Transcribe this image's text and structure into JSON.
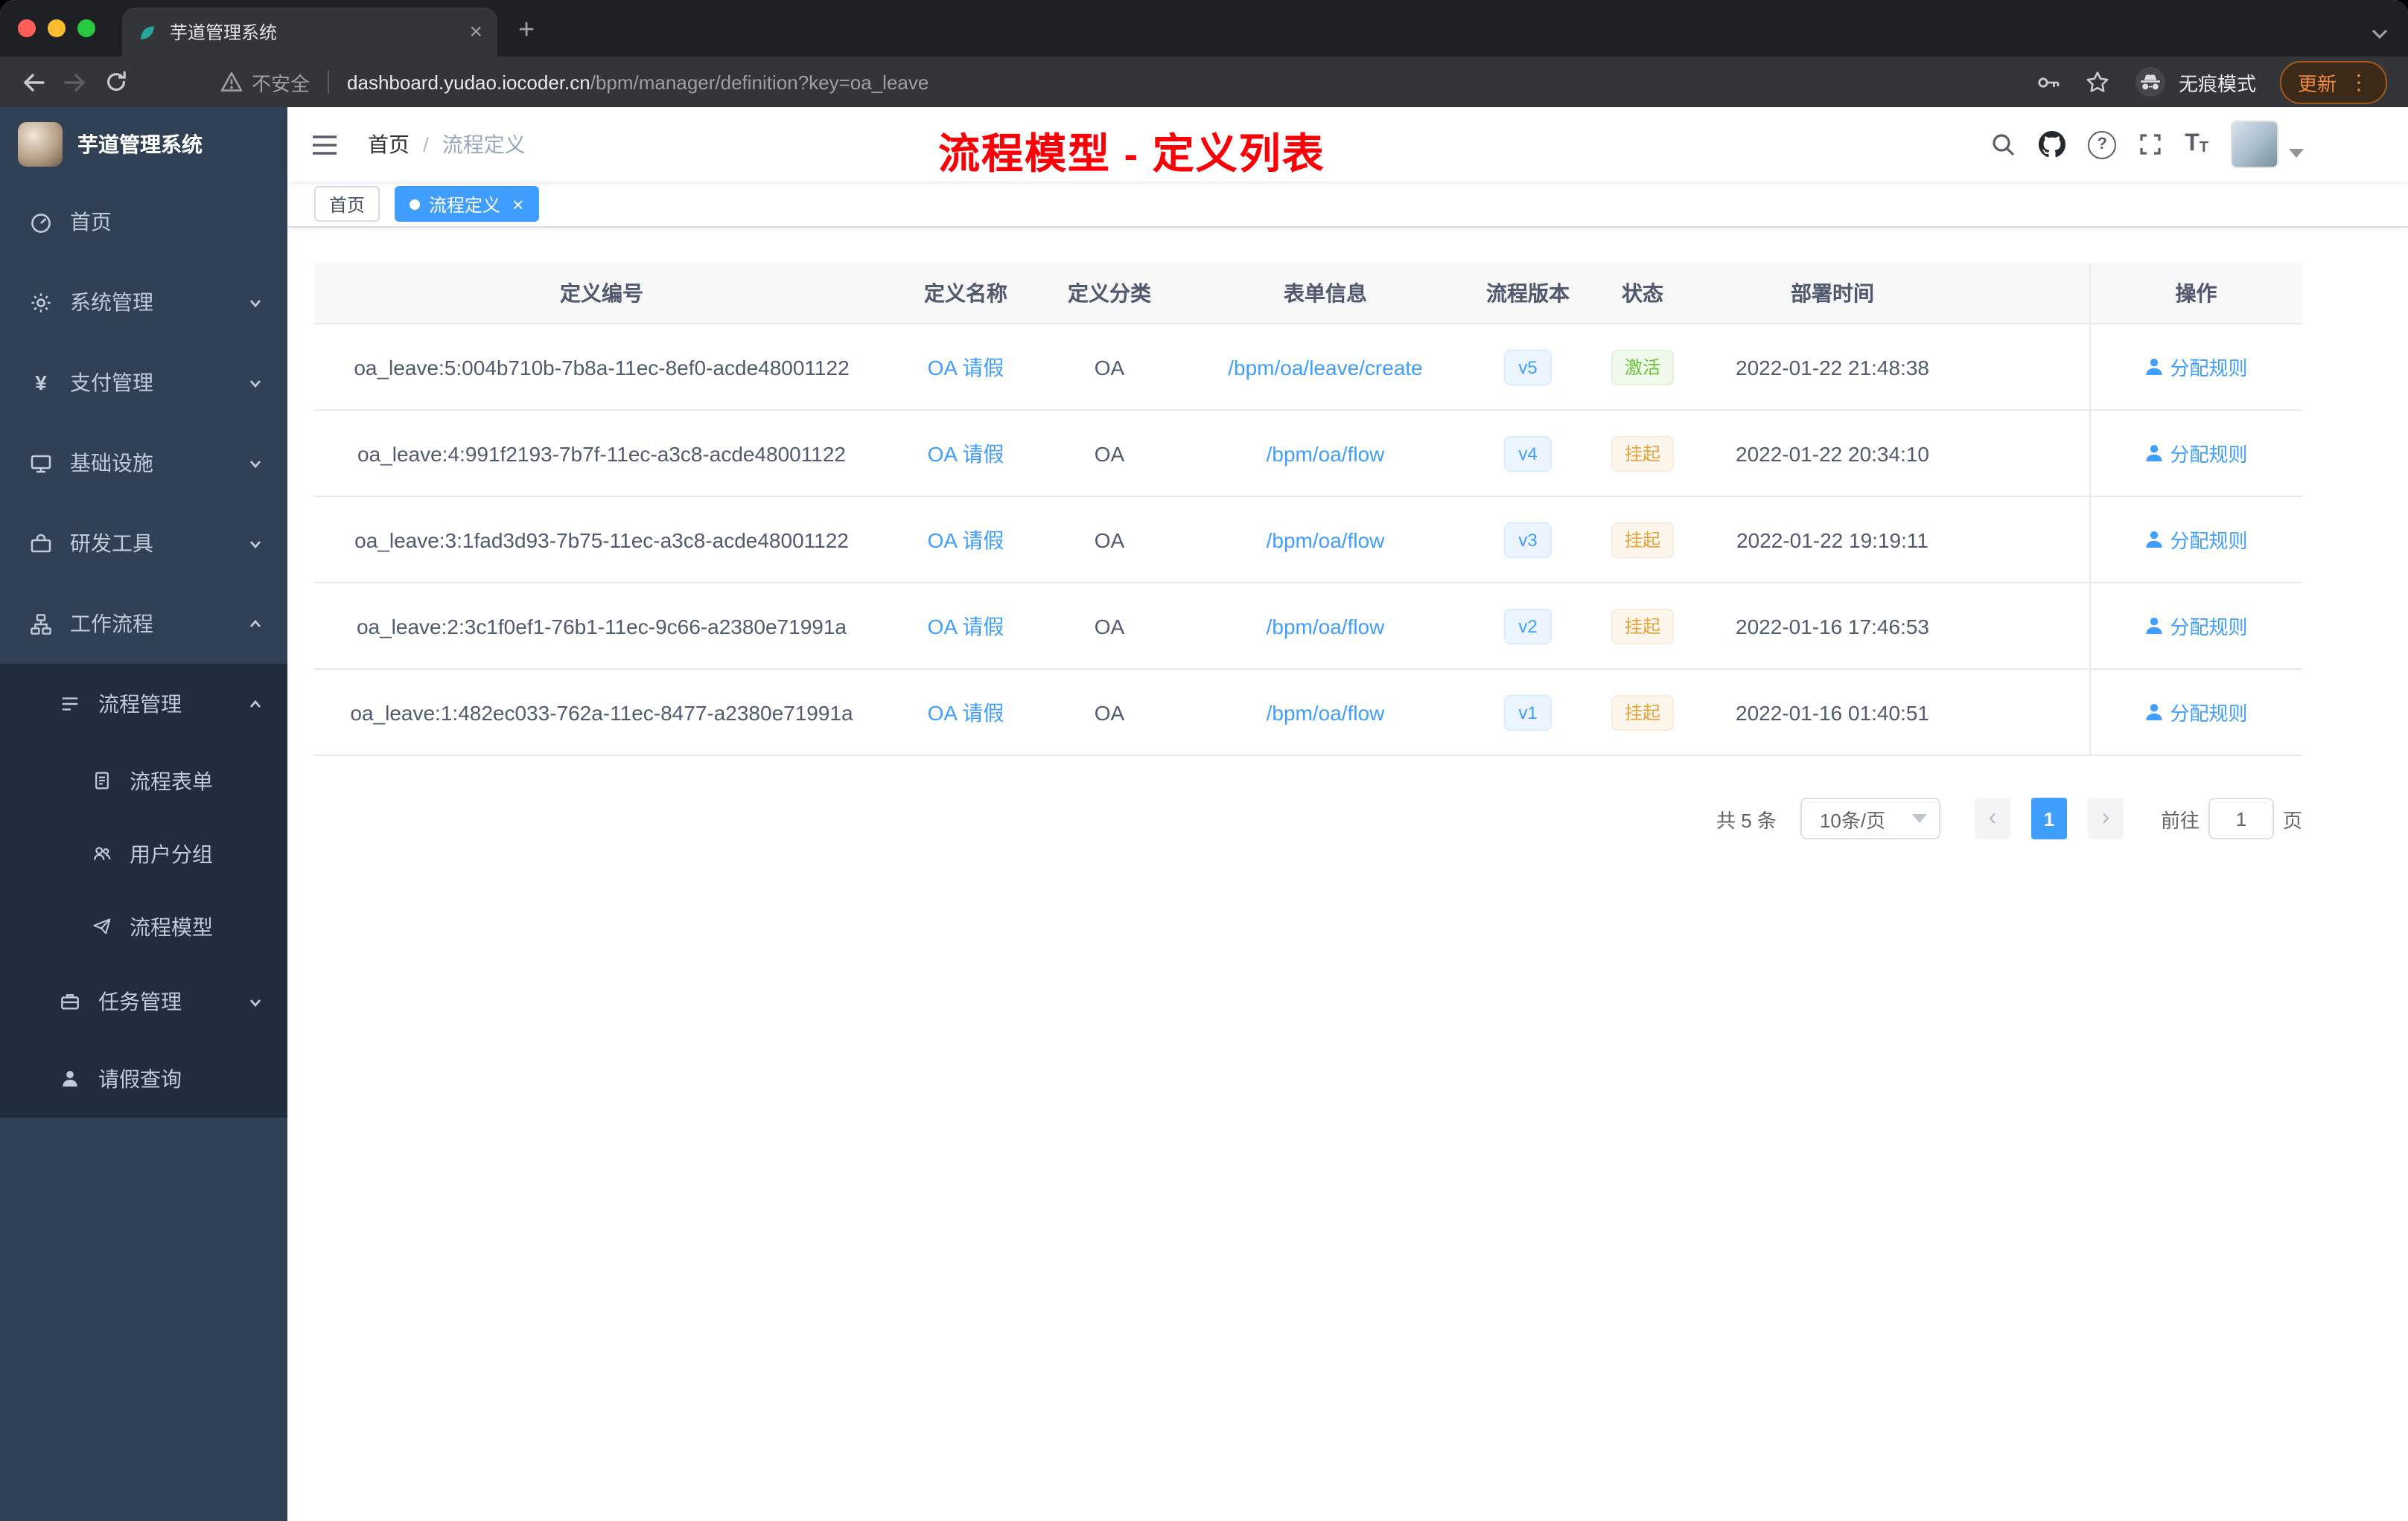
{
  "browser": {
    "tab_title": "芋道管理系统",
    "security_label": "不安全",
    "url_host": "dashboard.yudao.iocoder.cn",
    "url_path": "/bpm/manager/definition?key=oa_leave",
    "incognito_label": "无痕模式",
    "update_label": "更新"
  },
  "glyphs": {
    "close": "×",
    "plus": "+",
    "dots": "⋮",
    "prev": "‹",
    "next": "›",
    "question": "?",
    "t_large": "T",
    "t_small": "T"
  },
  "sidebar": {
    "brand": "芋道管理系统",
    "items": [
      {
        "label": "首页"
      },
      {
        "label": "系统管理"
      },
      {
        "label": "支付管理"
      },
      {
        "label": "基础设施"
      },
      {
        "label": "研发工具"
      },
      {
        "label": "工作流程"
      }
    ],
    "workflow": [
      {
        "label": "流程管理"
      },
      {
        "label": "流程表单"
      },
      {
        "label": "用户分组"
      },
      {
        "label": "流程模型"
      },
      {
        "label": "任务管理"
      },
      {
        "label": "请假查询"
      }
    ]
  },
  "header": {
    "breadcrumb_home": "首页",
    "breadcrumb_sep": "/",
    "breadcrumb_current": "流程定义",
    "annotation": "流程模型 - 定义列表"
  },
  "tags": [
    {
      "label": "首页"
    },
    {
      "label": "流程定义"
    }
  ],
  "table": {
    "columns": [
      "定义编号",
      "定义名称",
      "定义分类",
      "表单信息",
      "流程版本",
      "状态",
      "部署时间",
      "操作"
    ],
    "rows": [
      {
        "id": "oa_leave:5:004b710b-7b8a-11ec-8ef0-acde48001122",
        "name": "OA 请假",
        "category": "OA",
        "form": "/bpm/oa/leave/create",
        "version": "v5",
        "status": "激活",
        "deployed": "2022-01-22 21:48:38",
        "action": "分配规则"
      },
      {
        "id": "oa_leave:4:991f2193-7b7f-11ec-a3c8-acde48001122",
        "name": "OA 请假",
        "category": "OA",
        "form": "/bpm/oa/flow",
        "version": "v4",
        "status": "挂起",
        "deployed": "2022-01-22 20:34:10",
        "action": "分配规则"
      },
      {
        "id": "oa_leave:3:1fad3d93-7b75-11ec-a3c8-acde48001122",
        "name": "OA 请假",
        "category": "OA",
        "form": "/bpm/oa/flow",
        "version": "v3",
        "status": "挂起",
        "deployed": "2022-01-22 19:19:11",
        "action": "分配规则"
      },
      {
        "id": "oa_leave:2:3c1f0ef1-76b1-11ec-9c66-a2380e71991a",
        "name": "OA 请假",
        "category": "OA",
        "form": "/bpm/oa/flow",
        "version": "v2",
        "status": "挂起",
        "deployed": "2022-01-16 17:46:53",
        "action": "分配规则"
      },
      {
        "id": "oa_leave:1:482ec033-762a-11ec-8477-a2380e71991a",
        "name": "OA 请假",
        "category": "OA",
        "form": "/bpm/oa/flow",
        "version": "v1",
        "status": "挂起",
        "deployed": "2022-01-16 01:40:51",
        "action": "分配规则"
      }
    ]
  },
  "pagination": {
    "total": "共 5 条",
    "page_size": "10条/页",
    "page": "1",
    "goto_label": "前往",
    "goto_value": "1",
    "unit": "页"
  },
  "colors": {
    "accent": "#409eff",
    "success": "#67c23a",
    "warning": "#e6a23c",
    "annotation": "#ff0000",
    "sidebar_bg": "#304156",
    "submenu_bg": "#1f2d3d",
    "tag_active_bg": "#409eff"
  }
}
